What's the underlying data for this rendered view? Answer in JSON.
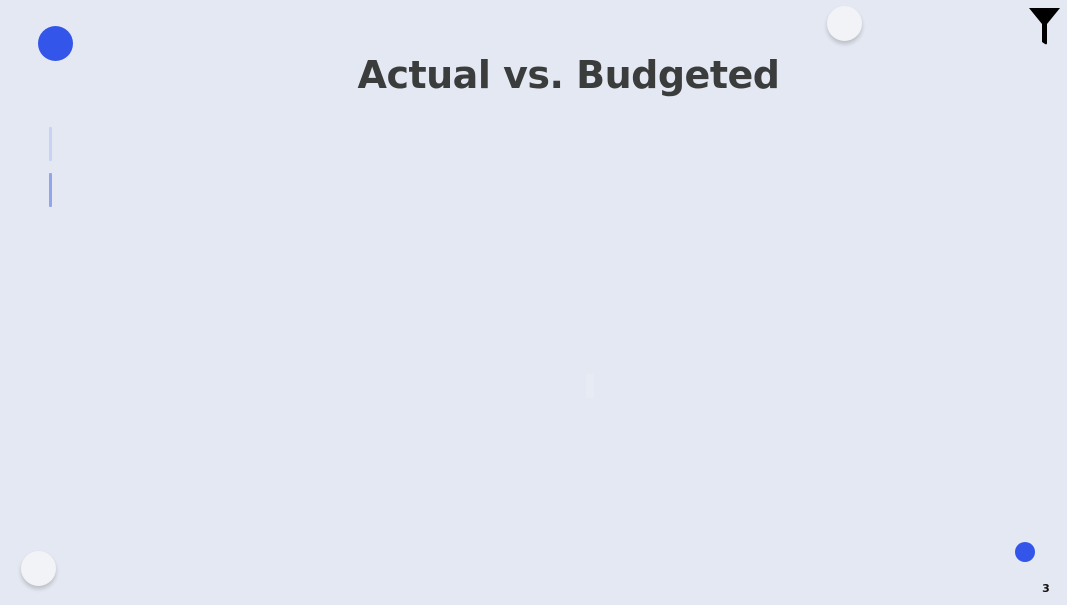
{
  "page": {
    "title": "Actual vs. Budgeted",
    "page_number": "3"
  },
  "colors": {
    "background": "#e4e8f2",
    "accent_blue": "#3355ea",
    "title_text": "#3a3d3b",
    "nav_bar_light": "#c9d1f5",
    "nav_bar_dark": "#93a4ef",
    "filter_icon": "#000000"
  },
  "icons": {
    "filter": "filter-funnel-icon"
  }
}
